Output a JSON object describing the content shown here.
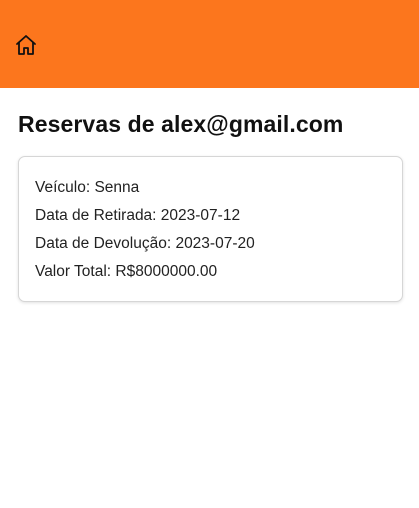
{
  "header": {
    "home_icon": "home-icon",
    "background_color": "#fc761d"
  },
  "page": {
    "title": "Reservas de alex@gmail.com"
  },
  "reservation": {
    "vehicle": "Veículo: Senna",
    "pickup_date": "Data de Retirada: 2023-07-12",
    "return_date": "Data de Devolução: 2023-07-20",
    "total_value": "Valor Total: R$8000000.00"
  }
}
